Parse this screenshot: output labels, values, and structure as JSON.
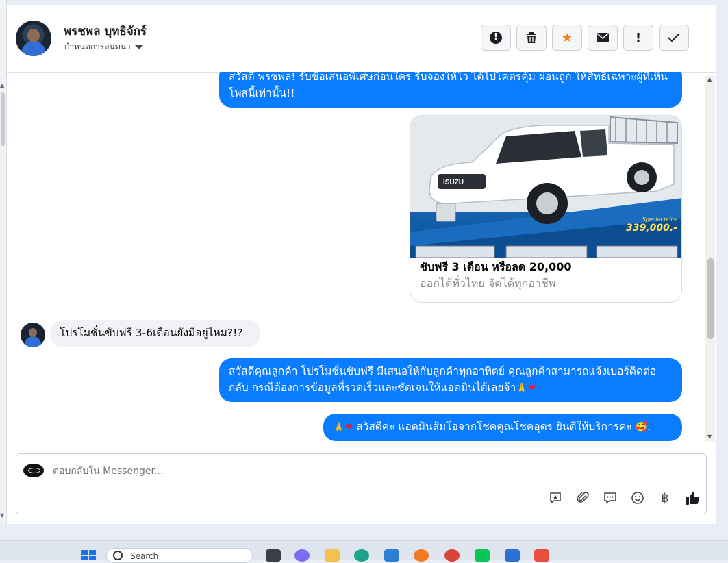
{
  "header": {
    "contact_name": "พรชพล บุทธิจักร์",
    "assign_label": "กำหนดการสนทนา",
    "actions": [
      {
        "name": "spam-button",
        "icon": "alert-circle-icon"
      },
      {
        "name": "delete-button",
        "icon": "trash-icon"
      },
      {
        "name": "star-button",
        "icon": "star-icon"
      },
      {
        "name": "mark-unread-button",
        "icon": "envelope-icon"
      },
      {
        "name": "follow-up-button",
        "icon": "exclamation-icon"
      },
      {
        "name": "mark-done-button",
        "icon": "check-icon"
      }
    ]
  },
  "messages": {
    "m1": "สวัสดี พรชพล! รับข้อเสนอพิเศษก่อนใคร รีบจองให้ไว ได้ไปโคตรคุ้ม ผ่อนถูก ให้สิทธิ์เฉพาะผู้ที่เห็นโพสนี้เท่านั้น!!",
    "ad_title": "ขับฟรี 3 เดือน หรือลด 20,000",
    "ad_subtitle": "ออกได้ทั่วไทย จัดได้ทุกอาชีพ",
    "ad_special": "Special price",
    "ad_price": "339,000.-",
    "ad_brand": "ISUZU",
    "m2": "โปรโมชั่นขับฟรี 3-6เดือนยังมีอยู่ไหม?!?",
    "m3": "สวัสดีคุณลูกค้า โปรโมชั่นขับฟรี มีเสนอให้กับลูกค้าทุกอาทิตย์ คุณลูกค้าสามารถแจ้งเบอร์ติดต่อกลับ กรณีต้องการข้อมูลที่รวดเร็วและชัดเจนให้แอดมินได้เลยจ้า",
    "m4": "สวัสดีค่ะ แอดมินส้มโอจากโชคคูณโชคอุดร ยินดีให้บริการค่ะ",
    "m4_end": "."
  },
  "composer": {
    "placeholder": "ตอบกลับใน Messenger..."
  },
  "taskbar": {
    "search_label": "Search"
  },
  "colors": {
    "outgoing_bubble": "#0a7cff",
    "incoming_bubble": "#f0f2f5",
    "star": "#f0811a"
  }
}
